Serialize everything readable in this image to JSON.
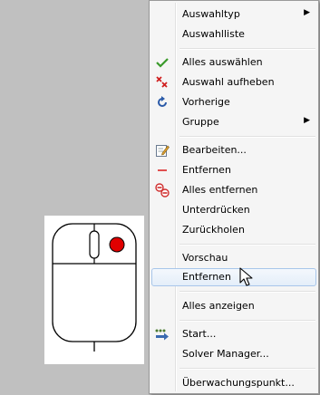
{
  "menu": {
    "items": [
      {
        "label": "Auswahltyp",
        "icon": null,
        "submenu": true
      },
      {
        "label": "Auswahlliste",
        "icon": null
      },
      {
        "label": "Alles auswählen",
        "icon": "green-check-icon"
      },
      {
        "label": "Auswahl aufheben",
        "icon": "red-x-icon"
      },
      {
        "label": "Vorherige",
        "icon": "blue-refresh-icon"
      },
      {
        "label": "Gruppe",
        "icon": null,
        "submenu": true
      },
      {
        "label": "Bearbeiten...",
        "icon": "edit-document-icon"
      },
      {
        "label": "Entfernen",
        "icon": "red-minus-icon"
      },
      {
        "label": "Alles entfernen",
        "icon": "remove-all-icon"
      },
      {
        "label": "Unterdrücken",
        "icon": null
      },
      {
        "label": "Zurückholen",
        "icon": null
      },
      {
        "label": "Vorschau",
        "icon": null
      },
      {
        "label": "Entfernen",
        "icon": null,
        "highlighted": true
      },
      {
        "label": "Alles anzeigen",
        "icon": null
      },
      {
        "label": "Start...",
        "icon": "start-arrow-icon"
      },
      {
        "label": "Solver Manager...",
        "icon": null
      },
      {
        "label": "Überwachungspunkt...",
        "icon": null
      }
    ]
  },
  "submenu_arrow": "▶",
  "colors": {
    "background": "#c0c0c0",
    "menu_bg": "#f5f5f5",
    "highlight_border": "#a8c6ea",
    "mouse_button_dot": "#e00000"
  }
}
